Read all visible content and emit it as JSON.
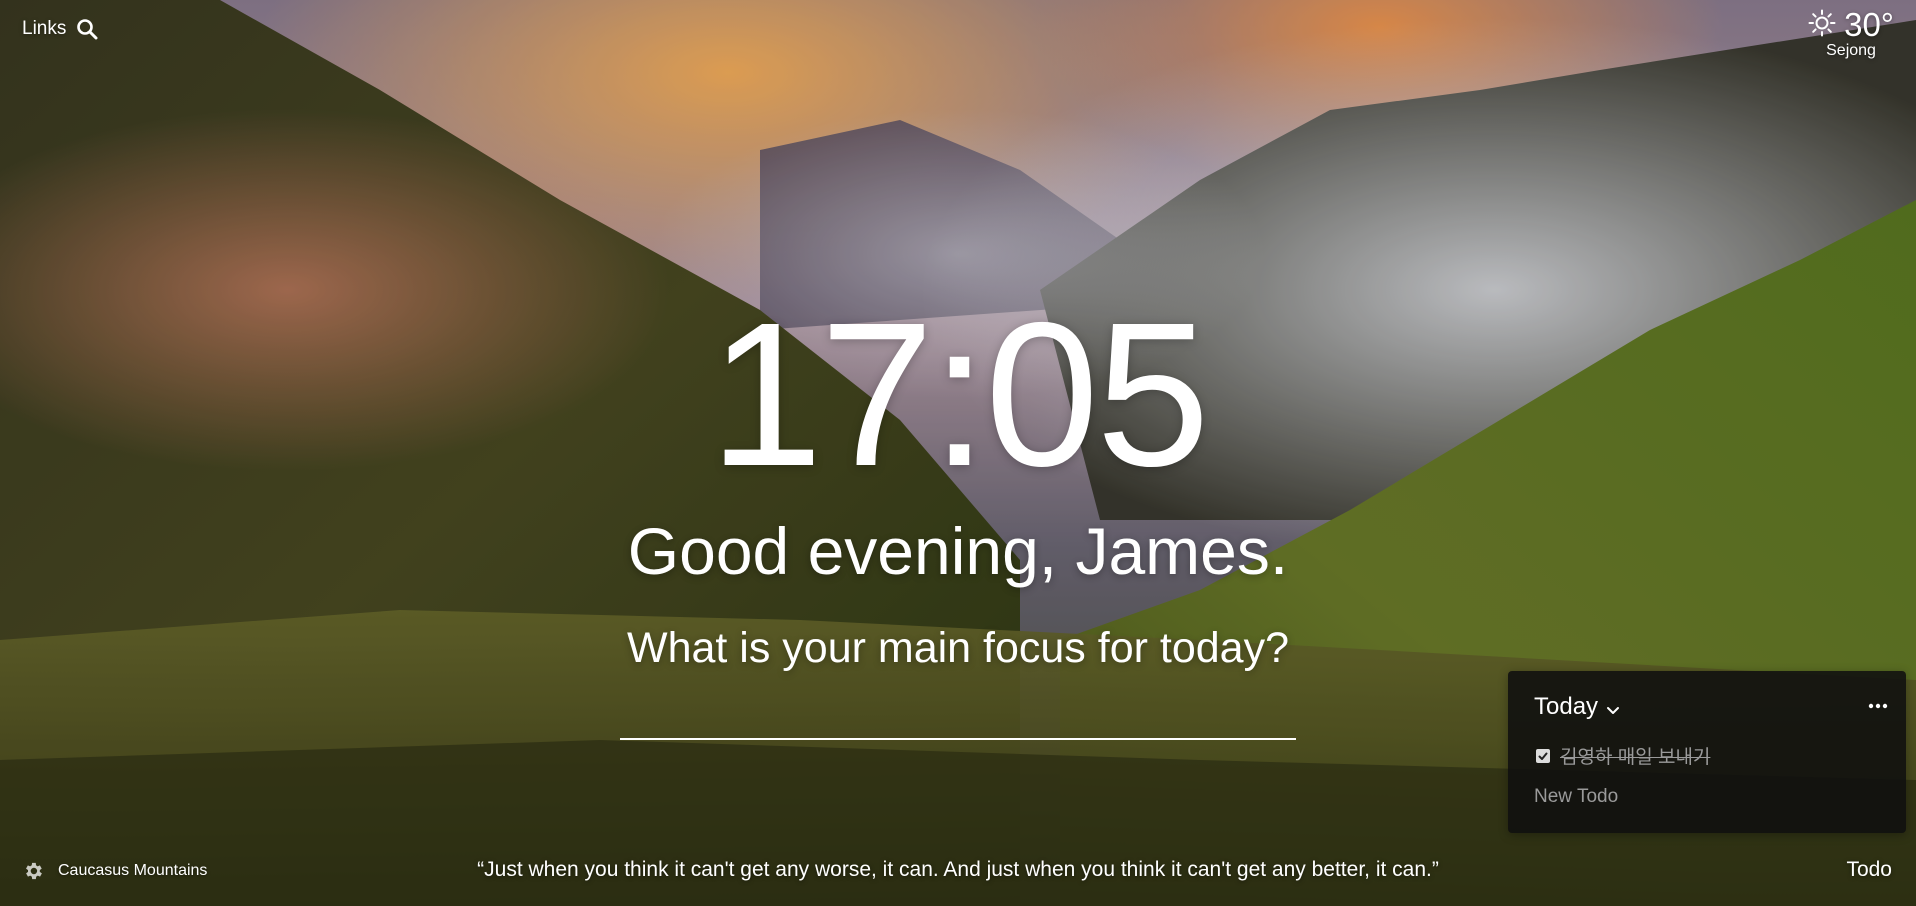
{
  "header": {
    "links_label": "Links",
    "search_icon": "search-icon"
  },
  "weather": {
    "icon": "sun-icon",
    "temperature": "30°",
    "location": "Sejong"
  },
  "clock": {
    "time": "17:05"
  },
  "greeting": {
    "text": "Good evening, James."
  },
  "focus": {
    "question": "What is your main focus for today?",
    "input_value": ""
  },
  "todo": {
    "list_name": "Today",
    "items": [
      {
        "label": "김영하 매일 보내기",
        "done": true
      }
    ],
    "new_placeholder": "New Todo",
    "toggle_label": "Todo"
  },
  "footer": {
    "settings_icon": "gear-icon",
    "photo_location": "Caucasus Mountains",
    "quote": "“Just when you think it can't get any worse, it can. And just when you think it can't get any better, it can.”"
  },
  "colors": {
    "panel_bg": "#0f0f0f",
    "muted_text": "#9a9a9a"
  }
}
